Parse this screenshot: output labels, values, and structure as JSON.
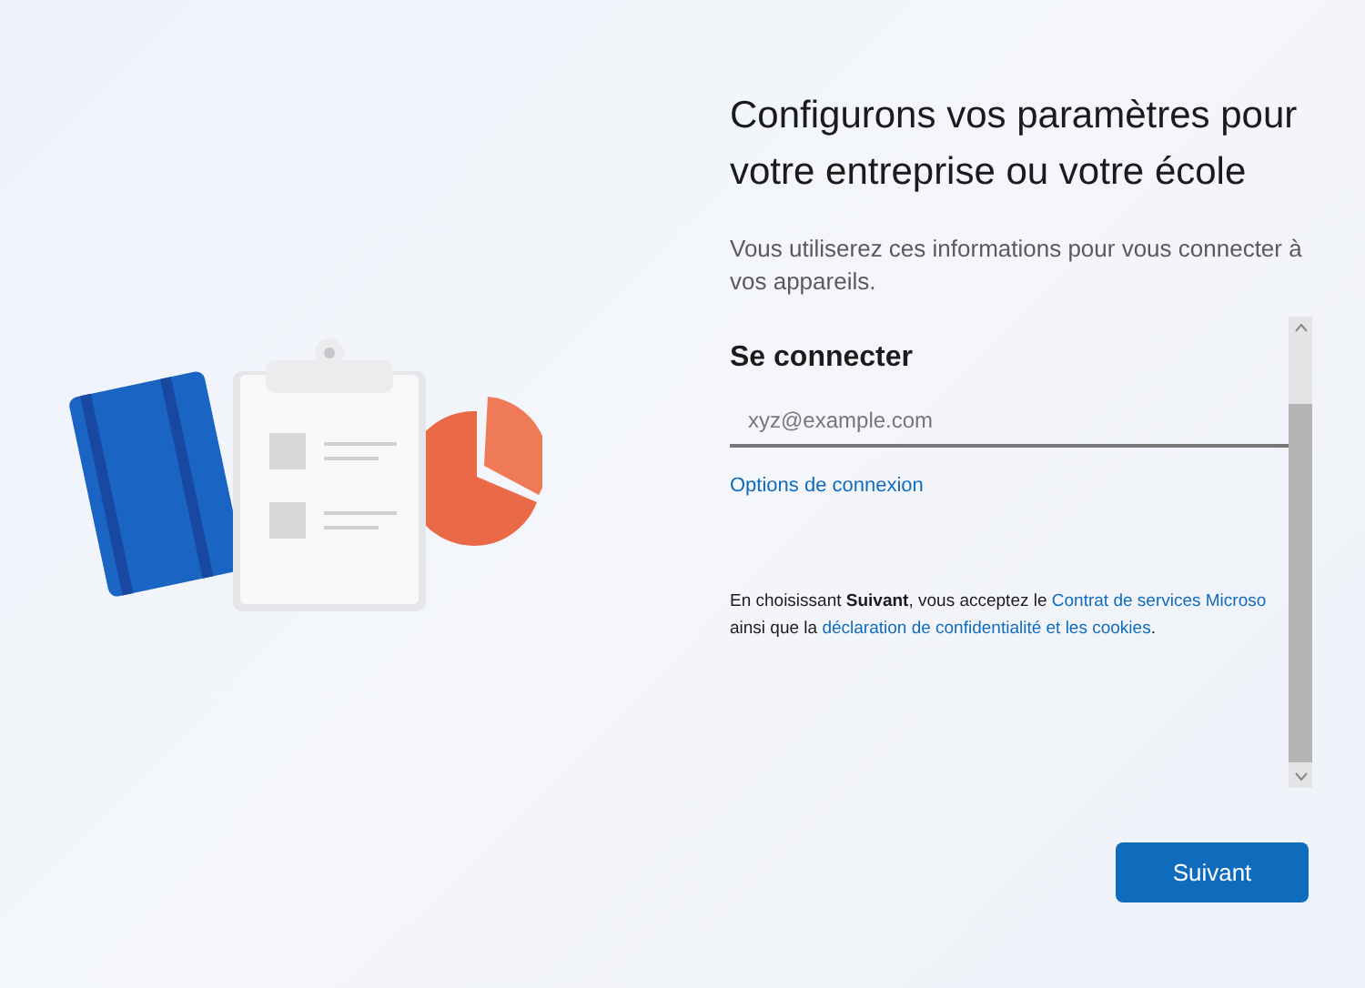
{
  "heading": "Configurons vos paramètres pour votre entreprise ou votre école",
  "description": "Vous utiliserez ces informations pour vous connecter à vos appareils.",
  "signin": {
    "title": "Se connecter",
    "placeholder": "xyz@example.com",
    "options_link": "Options de connexion",
    "legal": {
      "before": "En choisissant **Suivant**, vous acceptez le ",
      "link1": "Contrat de services Microso",
      "middle": "ainsi que la ",
      "link2": "déclaration de confidentialité et les cookies",
      "after": "."
    }
  },
  "next_button": "Suivant"
}
